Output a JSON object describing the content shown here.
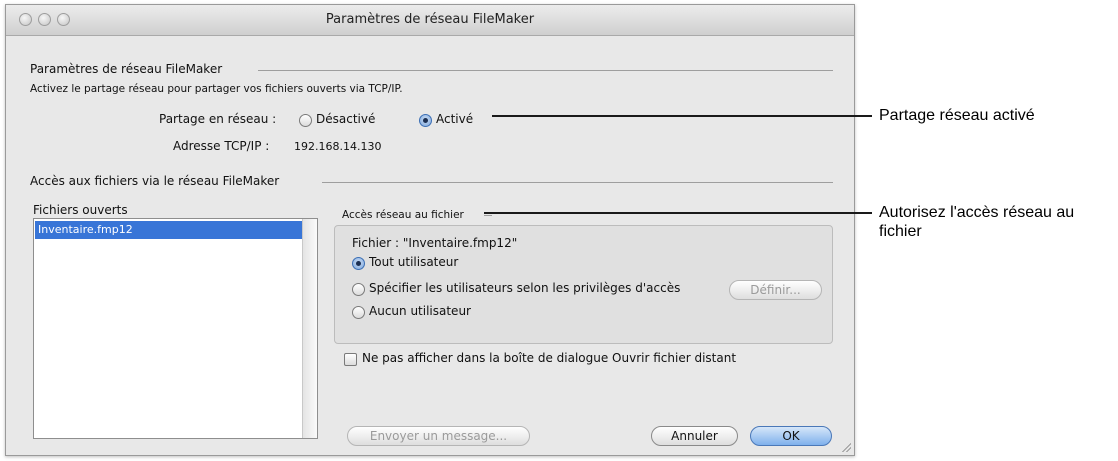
{
  "window": {
    "title": "Paramètres de réseau FileMaker"
  },
  "network_section": {
    "title": "Paramètres de réseau FileMaker",
    "description": "Activez le partage réseau pour partager vos fichiers ouverts via TCP/IP.",
    "sharing_label": "Partage en réseau :",
    "option_off": "Désactivé",
    "option_on": "Activé",
    "selected": "Activé",
    "tcp_label": "Adresse TCP/IP :",
    "tcp_value": "192.168.14.130"
  },
  "file_access_section": {
    "title": "Accès aux fichiers via le réseau FileMaker",
    "open_files_label": "Fichiers ouverts",
    "open_files": [
      "Inventaire.fmp12"
    ],
    "group_title": "Accès réseau au fichier",
    "file_label": "Fichier : \"Inventaire.fmp12\"",
    "option_all": "Tout utilisateur",
    "option_privileges": "Spécifier les utilisateurs selon les privilèges d'accès",
    "option_none": "Aucun utilisateur",
    "selected": "Tout utilisateur",
    "define_button": "Définir...",
    "hide_checkbox_label": "Ne pas afficher dans la boîte de dialogue Ouvrir fichier distant",
    "hide_checked": false
  },
  "footer": {
    "send_message_button": "Envoyer un message...",
    "cancel_button": "Annuler",
    "ok_button": "OK"
  },
  "callouts": {
    "sharing": "Partage réseau activé",
    "access_line1": "Autorisez l'accès réseau au",
    "access_line2": "fichier"
  }
}
